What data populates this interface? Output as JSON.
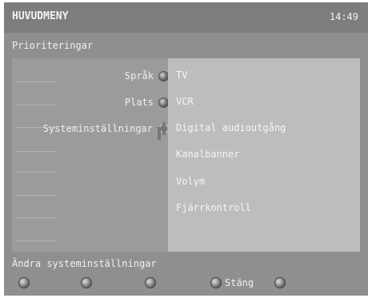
{
  "header": {
    "title": "HUVUDMENY",
    "time": "14:49"
  },
  "section": {
    "title": "Prioriteringar"
  },
  "left_menu": [
    {
      "label": "Språk"
    },
    {
      "label": "Plats"
    },
    {
      "label": "Systeminställningar"
    }
  ],
  "right_menu": [
    {
      "label": "TV"
    },
    {
      "label": "VCR"
    },
    {
      "label": "Digital audioutgång"
    },
    {
      "label": "Kanalbanner"
    },
    {
      "label": "Volym"
    },
    {
      "label": "Fjärrkontroll"
    }
  ],
  "status_text": "Ändra systeminställningar",
  "bottom_buttons": [
    {
      "label": ""
    },
    {
      "label": ""
    },
    {
      "label": ""
    },
    {
      "label": "Stäng"
    },
    {
      "label": ""
    }
  ]
}
